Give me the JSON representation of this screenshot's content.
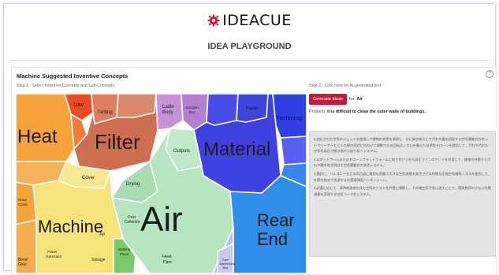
{
  "brand": {
    "name": "IDEACUE",
    "subtitle": "IDEA PLAYGROUND"
  },
  "panel": {
    "title": "Machine Suggested Inventive Concepts",
    "step1": "Step 1 - Select Inventive Concepts and Sub-Concepts",
    "step2": "Step 2 - Click here for AI-generated text",
    "help_icon": "question-circle-icon"
  },
  "generate": {
    "button_label": "Generate Ideas",
    "for_label": "for",
    "concept": "Air"
  },
  "problem": {
    "label": "Problem:",
    "text": "It is difficult to clean the outer walls of buildings."
  },
  "ideas": [
    "1.加圧された空気のジェットを使用して建物の外壁を清掃し、次に真空吸引にて汚れや塵を回収する空気駆動式ロボットクリーナーとビルの壁の形状に合わせて調整できる回転式ノズルを備えた自律型ドローンを使用して、汚れや汚れた空気を高圧で壁の面から取り払うシステム。",
    "2.ロボットアームまたはドローンプラットフォームに取り付けられた高圧ファンのアレイを利用して、建物の外壁から汚れや塵を吹き飛ばす空気駆動式の洗浄システム。",
    "3.膜状に、バルコニーなどの凹凸部に適切な距離で大きな空気流量を発生させる特殊な圧縮空気噴射ノズルを使用して、外壁を乾式で洗浄する外壁清掃用ハンディツール。",
    "4.必要に応じて、清浄剤溶液を含む空気のミストを外壁に噴射し、その後空気で洗い流すことで、環境負荷の少ない外壁清掃を実現する空気ベースのシステム。"
  ],
  "voronoi": {
    "cells": [
      {
        "label": "Heat",
        "color": "#f6a33c",
        "size": "xl"
      },
      {
        "label": "Filter",
        "color": "#cf6f52",
        "size": "xl"
      },
      {
        "label": "Material",
        "color": "#3f41e0",
        "size": "xl"
      },
      {
        "label": "Air",
        "color": "#b6e5bf",
        "size": "xxl"
      },
      {
        "label": "Machine",
        "color": "#f6e37a",
        "size": "xl"
      },
      {
        "label": "Rear End",
        "color": "#2f8ee8",
        "size": "xl"
      },
      {
        "label": "Uav",
        "color": "#eb4c23",
        "size": "s"
      },
      {
        "label": "Ladle Body",
        "color": "#c692da",
        "size": "xs"
      },
      {
        "label": "Junction Box",
        "color": "#c692da",
        "size": "xs"
      },
      {
        "label": "Fastening",
        "color": "#2f3fe4",
        "size": "s"
      },
      {
        "label": "Panel",
        "color": "#3e44e0",
        "size": "xs"
      },
      {
        "label": "Setting",
        "color": "#cf6f52",
        "size": "xs"
      },
      {
        "label": "Drying",
        "color": "#b6e5bf",
        "size": "xs"
      },
      {
        "label": "Outputs",
        "color": "#b6e5bf",
        "size": "xs"
      },
      {
        "label": "Dust Collector",
        "color": "#b6e5bf",
        "size": "xs"
      },
      {
        "label": "Heat Pipe",
        "color": "#b6e5bf",
        "size": "xs"
      },
      {
        "label": "Cover",
        "color": "#f6e37a",
        "size": "xs"
      },
      {
        "label": "Power Generator",
        "color": "#f6e37a",
        "size": "xs"
      },
      {
        "label": "Braking Piece",
        "color": "#7cc96a",
        "size": "xs"
      },
      {
        "label": "Bevel Gear",
        "color": "#f6a33c",
        "size": "xs"
      },
      {
        "label": "Rotor Cover",
        "color": "#f6a33c",
        "size": "xs"
      },
      {
        "label": "Face Antimicrobial Box",
        "color": "#b8b9f4",
        "size": "xs"
      },
      {
        "label": "Storage",
        "color": "#f6e37a",
        "size": "xs"
      },
      {
        "label": "Air",
        "color": "#f6e37a",
        "size": "xs"
      }
    ]
  }
}
